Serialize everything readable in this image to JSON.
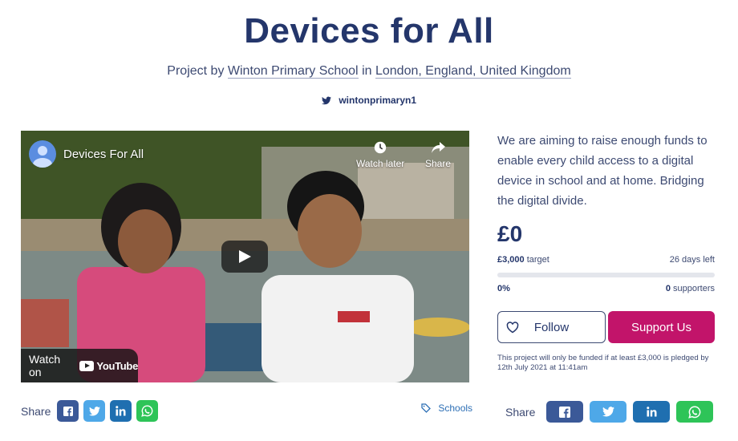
{
  "project": {
    "title": "Devices for All",
    "by_prefix": "Project by",
    "school": "Winton Primary School",
    "in_word": "in",
    "location": "London, England, United Kingdom",
    "twitter_handle": "wintonprimaryn1"
  },
  "video": {
    "channel_title": "Devices For All",
    "watch_later": "Watch later",
    "share": "Share",
    "watch_on": "Watch on",
    "youtube": "YouTube"
  },
  "share_left": {
    "label": "Share",
    "buttons": [
      "facebook",
      "twitter",
      "linkedin",
      "whatsapp"
    ]
  },
  "category_tag": "Schools",
  "funding": {
    "description": "We are aiming to raise enough funds to enable every child access to a digital device in school and at home. Bridging the digital divide.",
    "raised": "£0",
    "target_value": "£3,000",
    "target_word": "target",
    "days_left": "26 days left",
    "percent": "0%",
    "progress": 0,
    "supporters_count": "0",
    "supporters_word": "supporters",
    "follow_label": "Follow",
    "support_label": "Support Us",
    "note": "This project will only be funded if at least £3,000 is pledged by 12th July 2021 at 11:41am"
  },
  "share_right": {
    "label": "Share",
    "buttons": [
      "facebook",
      "twitter",
      "linkedin",
      "whatsapp"
    ]
  },
  "colors": {
    "navy": "#24366b",
    "accent": "#c2146a",
    "facebook": "#3b5998",
    "twitter": "#4ea8e8",
    "linkedin": "#1f6fb0",
    "whatsapp": "#2ec458"
  }
}
